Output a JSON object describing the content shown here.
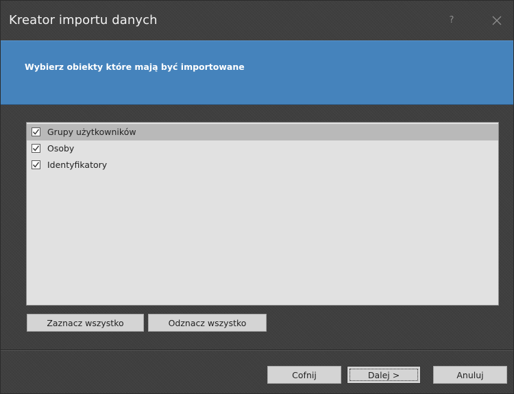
{
  "window": {
    "title": "Kreator importu danych",
    "help_label": "?",
    "close_icon": "close-icon"
  },
  "header": {
    "title": "Wybierz obiekty które mają być importowane",
    "background_color": "#4583bc"
  },
  "list": {
    "items": [
      {
        "label": "Grupy użytkowników",
        "checked": true,
        "selected": true
      },
      {
        "label": "Osoby",
        "checked": true,
        "selected": false
      },
      {
        "label": "Identyfikatory",
        "checked": true,
        "selected": false
      }
    ]
  },
  "selection_buttons": {
    "select_all": "Zaznacz wszystko",
    "deselect_all": "Odznacz wszystko"
  },
  "footer": {
    "back": "Cofnij",
    "next": "Dalej >",
    "cancel": "Anuluj"
  }
}
